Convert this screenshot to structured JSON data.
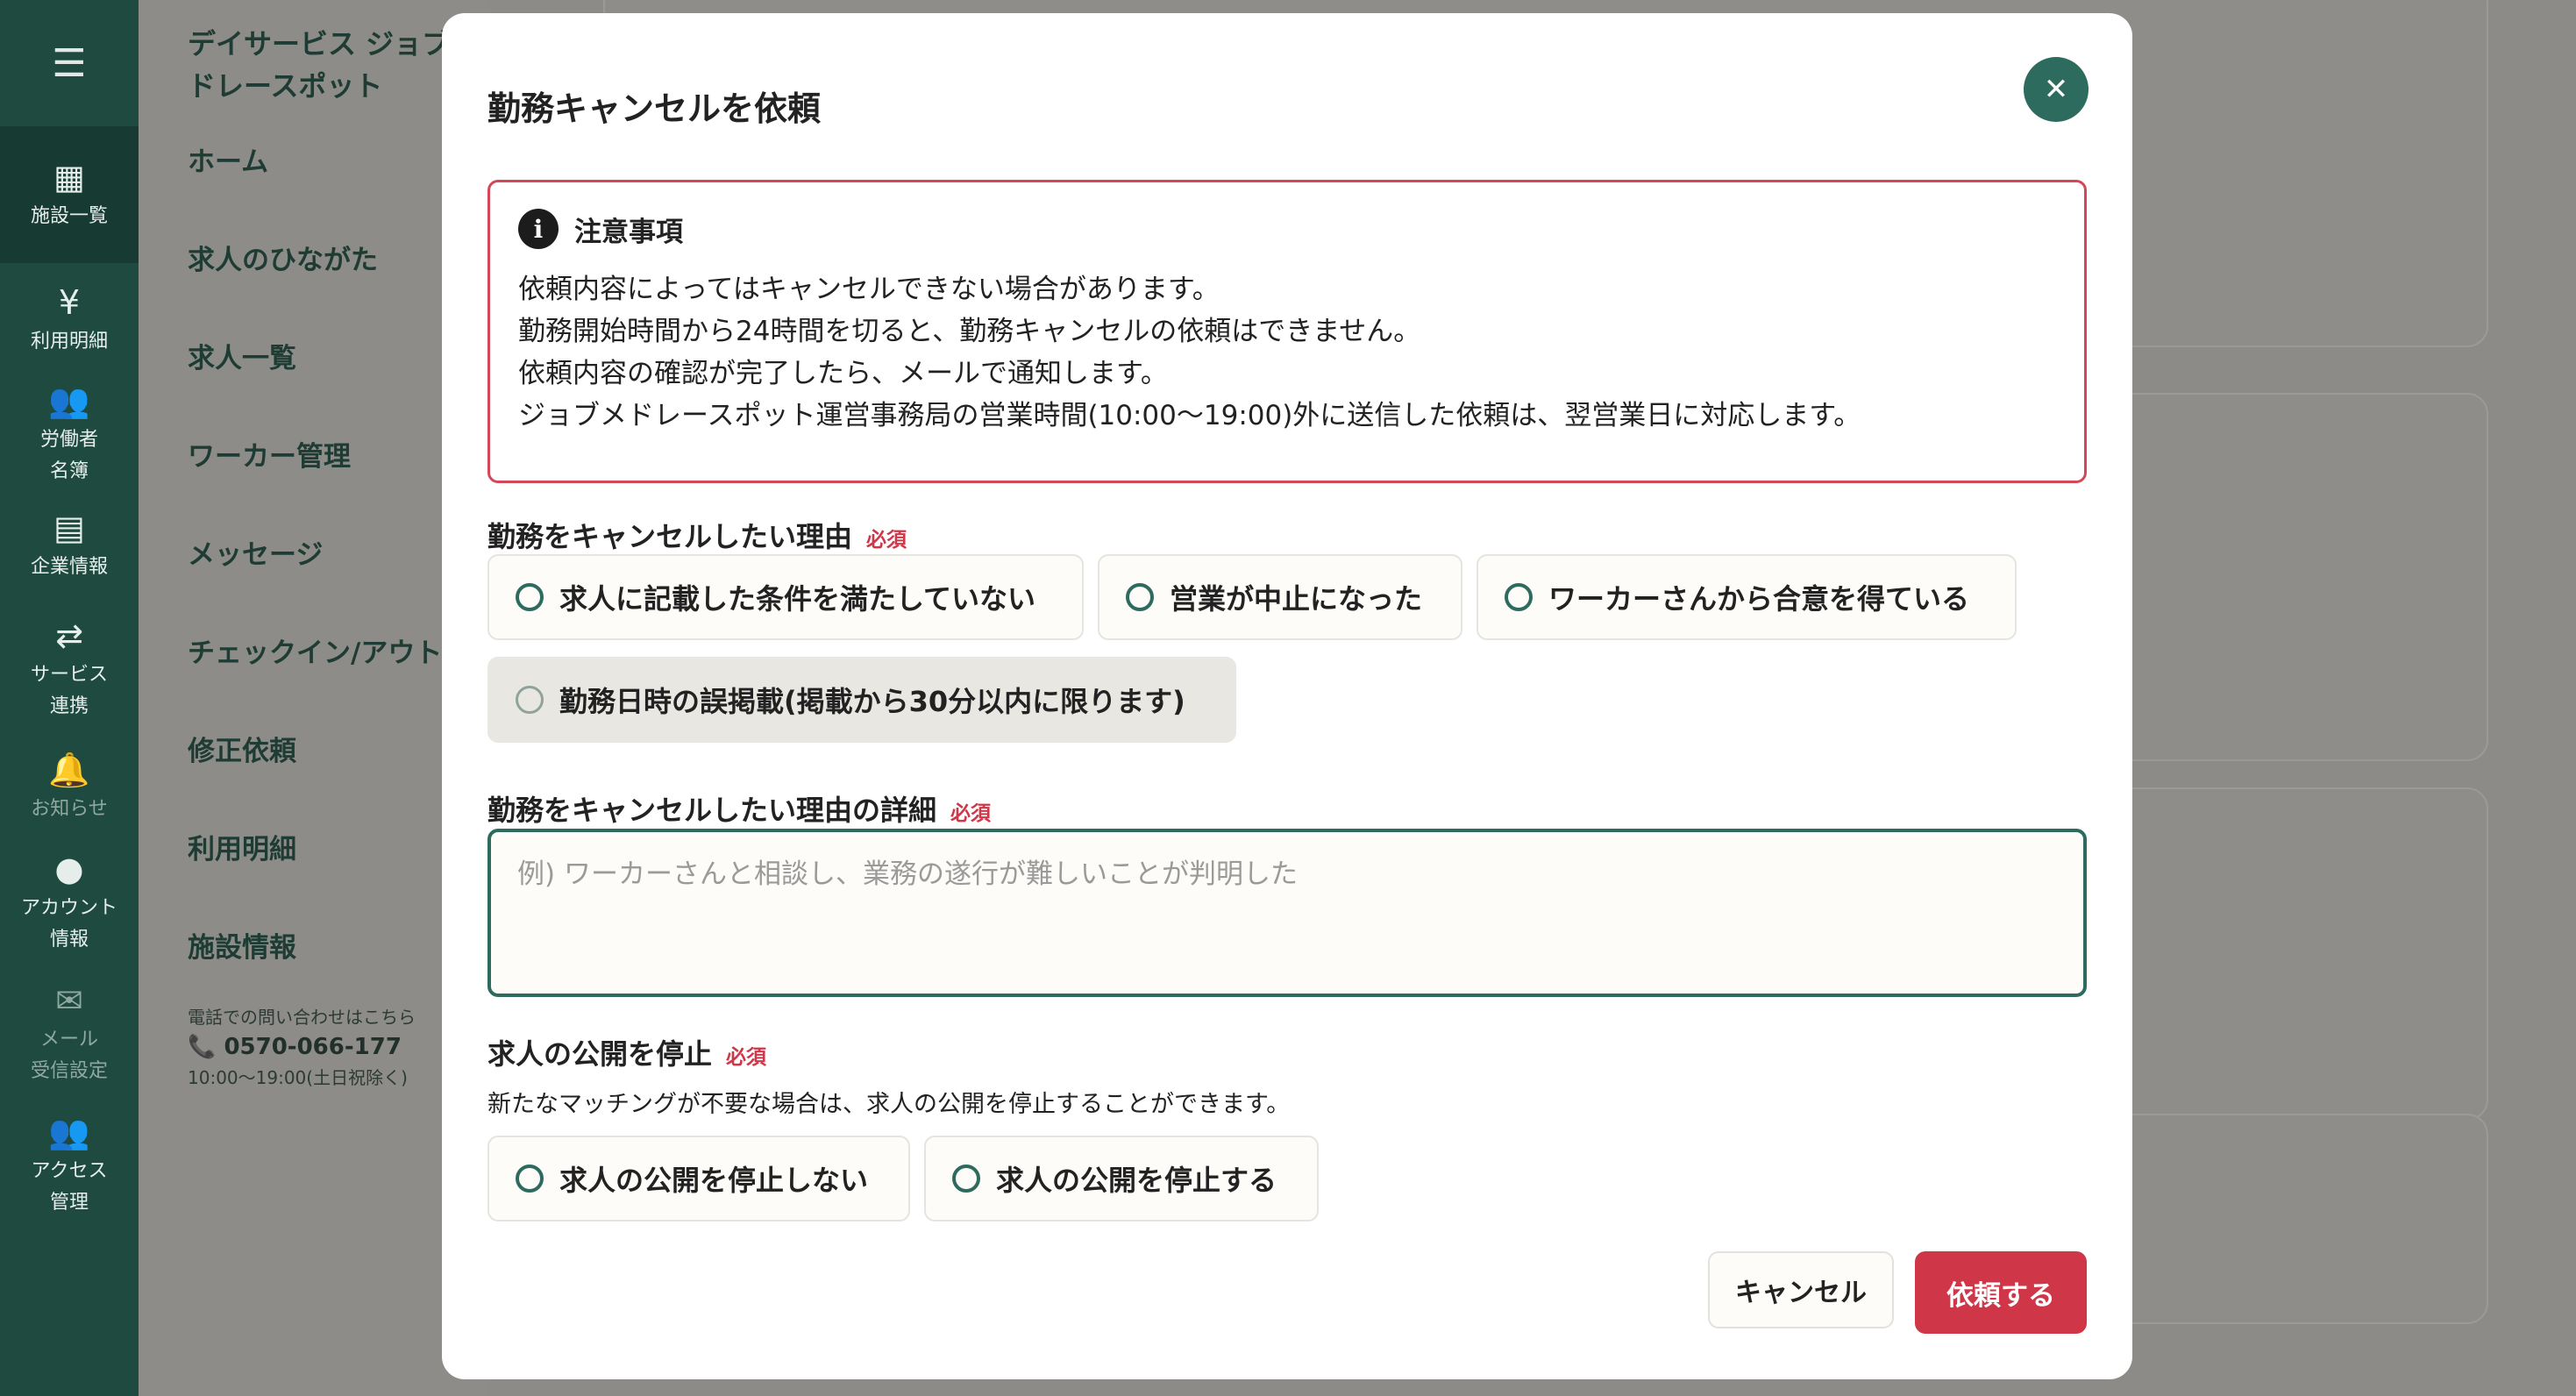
{
  "rail": {
    "menu_icon": "hamburger-icon",
    "items": [
      {
        "icon": "building-icon",
        "label": "施設一覧",
        "active": true
      },
      {
        "icon": "yen-document-icon",
        "label": "利用明細"
      },
      {
        "icon": "users-icon",
        "label": "労働者\n名簿"
      },
      {
        "icon": "document-icon",
        "label": "企業情報"
      },
      {
        "icon": "swap-icon",
        "label": "サービス\n連携"
      },
      {
        "icon": "bell-icon",
        "label": "お知らせ",
        "dim": true
      },
      {
        "icon": "person-icon",
        "label": "アカウント\n情報"
      },
      {
        "icon": "mail-icon",
        "label": "メール\n受信設定",
        "dim": true
      },
      {
        "icon": "users-icon",
        "label": "アクセス\n管理"
      }
    ]
  },
  "subnav": {
    "title": "デイサービス ジョブ\nドレースポット",
    "items": [
      "ホーム",
      "求人のひながた",
      "求人一覧",
      "ワーカー管理",
      "メッセージ",
      "チェックイン/アウト",
      "修正依頼",
      "利用明細",
      "施設情報"
    ],
    "phone_caption": "電話での問い合わせはこちら",
    "phone_number": "0570-066-177",
    "phone_hours": "10:00〜19:00(土日祝除く)"
  },
  "modal": {
    "title": "勤務キャンセルを依頼",
    "close_icon": "close-icon",
    "notice": {
      "title": "注意事項",
      "lines": [
        "依頼内容によってはキャンセルできない場合があります。",
        "勤務開始時間から24時間を切ると、勤務キャンセルの依頼はできません。",
        "依頼内容の確認が完了したら、メールで通知します。",
        "ジョブメドレースポット運営事務局の営業時間(10:00〜19:00)外に送信した依頼は、翌営業日に対応します。"
      ]
    },
    "reason": {
      "label": "勤務をキャンセルしたい理由",
      "required": "必須",
      "options": [
        "求人に記載した条件を満たしていない",
        "営業が中止になった",
        "ワーカーさんから合意を得ている",
        "勤務日時の誤掲載(掲載から30分以内に限ります)"
      ]
    },
    "detail": {
      "label": "勤務をキャンセルしたい理由の詳細",
      "required": "必須",
      "placeholder": "例) ワーカーさんと相談し、業務の遂行が難しいことが判明した",
      "value": ""
    },
    "stop": {
      "label": "求人の公開を停止",
      "required": "必須",
      "description": "新たなマッチングが不要な場合は、求人の公開を停止することができます。",
      "options": [
        "求人の公開を停止しない",
        "求人の公開を停止する"
      ]
    },
    "buttons": {
      "cancel": "キャンセル",
      "submit": "依頼する"
    }
  },
  "colors": {
    "primary": "#2d6b5e",
    "danger": "#cf3648",
    "rail": "#1f4a40"
  }
}
